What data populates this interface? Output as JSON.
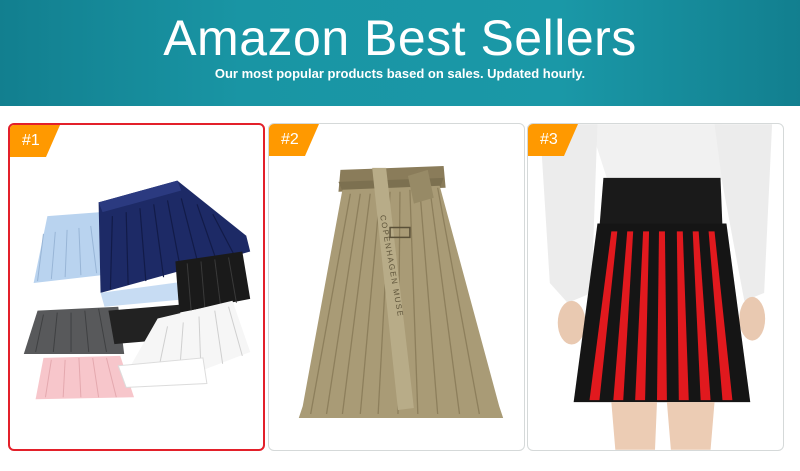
{
  "banner": {
    "title": "Amazon Best Sellers",
    "subtitle": "Our most popular products based on sales. Updated hourly."
  },
  "products": [
    {
      "rank": "#1",
      "image_icon": "pleated-mini-skirts-stack-image",
      "selected": true
    },
    {
      "rank": "#2",
      "image_icon": "khaki-pleated-midi-skirt-image",
      "selected": false
    },
    {
      "rank": "#3",
      "image_icon": "black-red-pleated-skirt-image",
      "selected": false
    }
  ],
  "product_image_text": "COPENHAGEN MUSE",
  "colors": {
    "banner": "#1995a4",
    "rank_badge": "#ff9900",
    "selected_border": "#e3202a"
  }
}
